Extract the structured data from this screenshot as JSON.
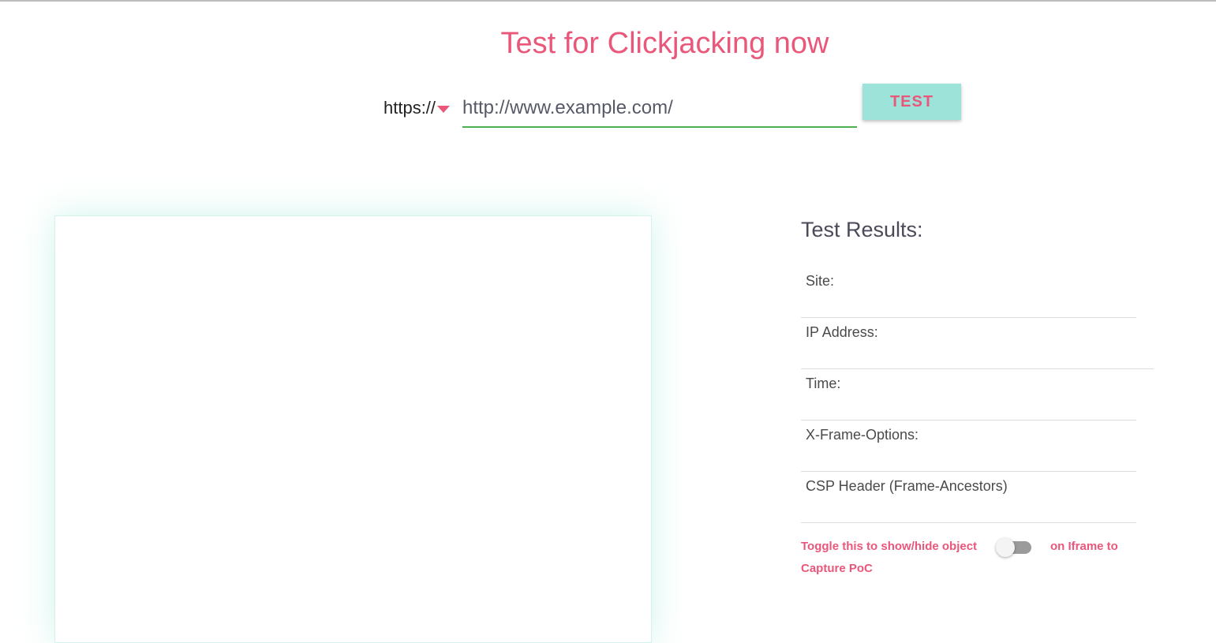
{
  "header": {
    "title": "Test for Clickjacking now"
  },
  "form": {
    "protocol": "https://",
    "url_value": "http://www.example.com/",
    "test_label": "TEST"
  },
  "results": {
    "title": "Test Results:",
    "rows": [
      {
        "label": "Site:"
      },
      {
        "label": "IP Address:"
      },
      {
        "label": "Time:"
      },
      {
        "label": "X-Frame-Options:"
      },
      {
        "label": "CSP Header (Frame-Ancestors)"
      }
    ],
    "toggle": {
      "text_before": "Toggle this to show/hide object",
      "text_after": "on Iframe to",
      "text_line2": "Capture PoC",
      "checked": false
    }
  },
  "colors": {
    "accent": "#e9577a",
    "button_bg": "#9ee3d9",
    "input_underline": "#4caf50"
  }
}
